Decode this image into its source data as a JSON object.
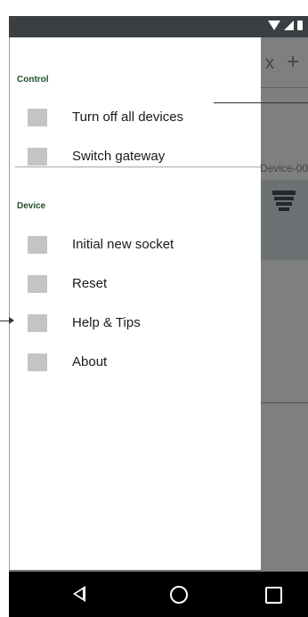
{
  "drawer": {
    "sections": [
      {
        "title": "Control",
        "items": [
          "Turn off all devices",
          "Switch gateway"
        ]
      },
      {
        "title": "Device",
        "items": [
          "Initial new socket",
          "Reset",
          "Help & Tips",
          "About"
        ]
      }
    ]
  },
  "background_app": {
    "toolbar_text": "x",
    "add_glyph": "+",
    "device_label": "Device-00"
  },
  "colors": {
    "section_title": "#1e4f2c",
    "scrim": "rgba(0,0,0,0.5)",
    "status_bar": "#3a3f41"
  }
}
